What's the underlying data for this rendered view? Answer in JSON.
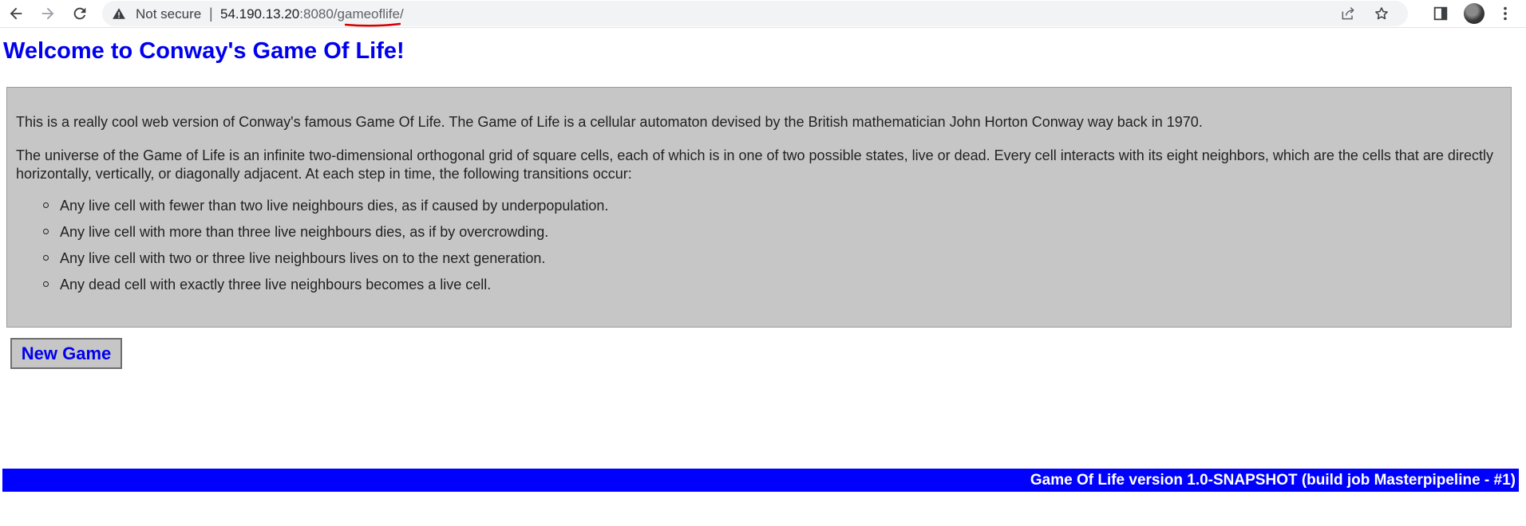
{
  "browser": {
    "security_label": "Not secure",
    "separator": "|",
    "url_host": "54.190.13.20",
    "url_port": ":8080/",
    "url_path": "gameoflife/",
    "back_icon": "arrow-left-icon",
    "forward_icon": "arrow-right-icon",
    "reload_icon": "reload-icon",
    "warning_icon": "warning-triangle-icon",
    "share_icon": "share-icon",
    "bookmark_icon": "star-icon",
    "sidepanel_icon": "side-panel-icon",
    "menu_icon": "kebab-menu-icon",
    "annotation_color": "#d40000"
  },
  "page": {
    "title": "Welcome to Conway's Game Of Life!",
    "intro": "This is a really cool web version of Conway's famous Game Of Life. The Game of Life is a cellular automaton devised by the British mathematician John Horton Conway way back in 1970.",
    "description": "The universe of the Game of Life is an infinite two-dimensional orthogonal grid of square cells, each of which is in one of two possible states, live or dead. Every cell interacts with its eight neighbors, which are the cells that are directly horizontally, vertically, or diagonally adjacent. At each step in time, the following transitions occur:",
    "rules": [
      "Any live cell with fewer than two live neighbours dies, as if caused by underpopulation.",
      "Any live cell with more than three live neighbours dies, as if by overcrowding.",
      "Any live cell with two or three live neighbours lives on to the next generation.",
      "Any dead cell with exactly three live neighbours becomes a live cell."
    ],
    "new_game_label": "New Game",
    "footer": "Game Of Life version 1.0-SNAPSHOT (build job Masterpipeline - #1)"
  },
  "colors": {
    "link_blue": "#0000ee",
    "footer_blue": "#0000ff",
    "box_gray": "#c6c6c6"
  }
}
